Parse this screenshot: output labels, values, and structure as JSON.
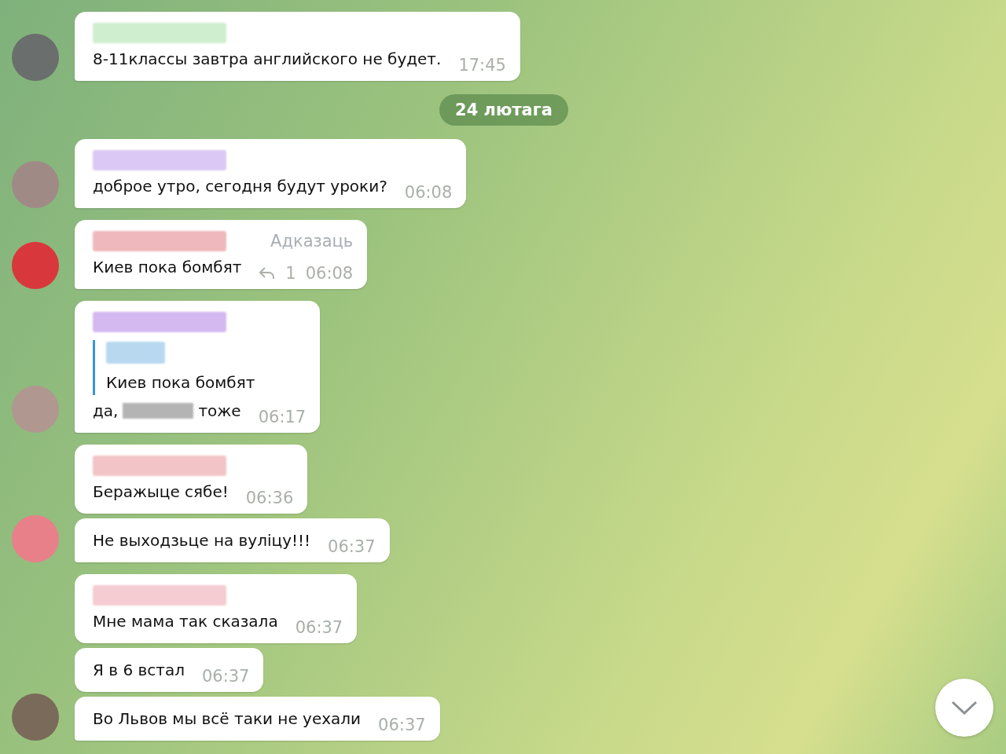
{
  "chat": [
    {
      "kind": "group",
      "avatar": {
        "color": "#6a6e6c"
      },
      "messages": [
        {
          "sender": {
            "color": "#cfeecf"
          },
          "text": "8-11классы завтра английского не будет.",
          "time": "17:45"
        }
      ]
    },
    {
      "kind": "date",
      "label": "24 лютага"
    },
    {
      "kind": "group",
      "avatar": {
        "color": "#a08a86"
      },
      "messages": [
        {
          "sender": {
            "color": "#dcc8f4"
          },
          "text": "доброе утро, сегодня будут уроки?",
          "time": "06:08"
        }
      ]
    },
    {
      "kind": "group",
      "avatar": {
        "color": "#d8383c"
      },
      "messages": [
        {
          "sender": {
            "color": "#efb8bc"
          },
          "text": "Киев пока бомбят",
          "time": "06:08",
          "reply_label": "Адказаць",
          "reply_count": "1"
        }
      ]
    },
    {
      "kind": "group",
      "avatar": {
        "color": "#b09890"
      },
      "messages": [
        {
          "sender": {
            "color": "#d4b8f0"
          },
          "quote": {
            "sender": {
              "color": "#b8d8f0"
            },
            "text": "Киев пока бомбят"
          },
          "text": "да,",
          "redacted": true,
          "text_after": "тоже",
          "time": "06:17"
        }
      ]
    },
    {
      "kind": "group",
      "avatar": {
        "color": "#e8808a"
      },
      "messages": [
        {
          "sender": {
            "color": "#f2c4c8"
          },
          "text": "Беражыце сябе!",
          "time": "06:36"
        },
        {
          "text": "Не выходзьце на вуліцу!!!",
          "time": "06:37"
        }
      ]
    },
    {
      "kind": "group",
      "avatar": {
        "color": "#7a6a5a"
      },
      "messages": [
        {
          "sender": {
            "color": "#f4ccd2"
          },
          "text": "Мне мама так сказала",
          "time": "06:37"
        },
        {
          "text": "Я в 6 встал",
          "time": "06:37"
        },
        {
          "text": "Во Львов мы всё таки не уехали",
          "time": "06:37"
        }
      ]
    }
  ]
}
